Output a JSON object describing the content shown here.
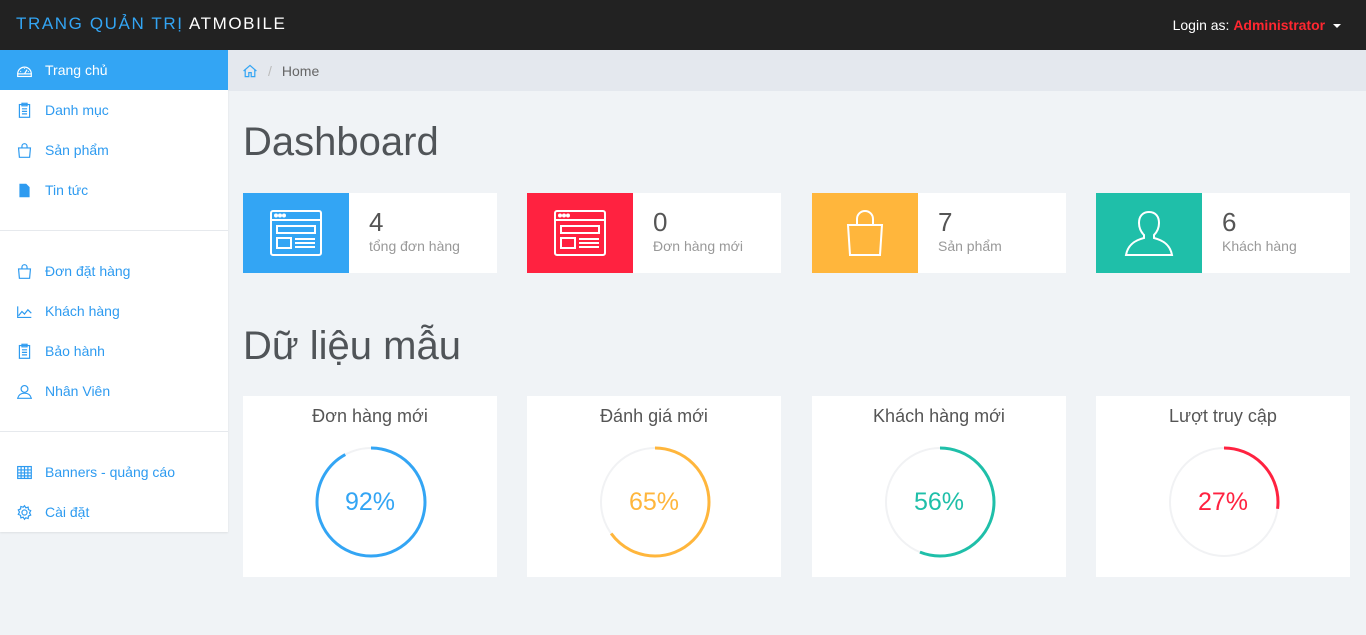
{
  "header": {
    "brand_part1": "TRANG QUẢN TRỊ",
    "brand_part2": "ATMOBILE",
    "login_prefix": "Login as:",
    "login_user": "Administrator"
  },
  "sidebar": {
    "items": [
      {
        "label": "Trang chủ",
        "icon": "dashboard-icon",
        "active": true
      },
      {
        "label": "Danh mục",
        "icon": "clipboard-list-icon"
      },
      {
        "label": "Sản phẩm",
        "icon": "shopping-bag-icon"
      },
      {
        "label": "Tin tức",
        "icon": "file-icon"
      },
      {
        "label": "Đơn đặt hàng",
        "icon": "shopping-bag-icon"
      },
      {
        "label": "Khách hàng",
        "icon": "line-chart-icon"
      },
      {
        "label": "Bảo hành",
        "icon": "clipboard-list-icon"
      },
      {
        "label": "Nhân Viên",
        "icon": "user-icon"
      },
      {
        "label": "Banners - quảng cáo",
        "icon": "table-grid-icon"
      },
      {
        "label": "Cài đặt",
        "icon": "gear-icon"
      }
    ]
  },
  "breadcrumb": {
    "current": "Home"
  },
  "dashboard": {
    "title": "Dashboard",
    "stats": [
      {
        "value": "4",
        "label": "tổng đơn hàng",
        "color": "#33a5f4",
        "icon": "browser-window-icon"
      },
      {
        "value": "0",
        "label": "Đơn hàng mới",
        "color": "#ff2240",
        "icon": "browser-window-icon"
      },
      {
        "value": "7",
        "label": "Sản phẩm",
        "color": "#ffb63c",
        "icon": "shopping-bag-icon"
      },
      {
        "value": "6",
        "label": "Khách hàng",
        "color": "#1fbfa9",
        "icon": "user-icon"
      }
    ]
  },
  "sample": {
    "title": "Dữ liệu mẫu",
    "gauges": [
      {
        "title": "Đơn hàng mới",
        "value_text": "92%",
        "percent": 92,
        "color": "#33a5f4"
      },
      {
        "title": "Đánh giá mới",
        "value_text": "65%",
        "percent": 65,
        "color": "#ffb63c"
      },
      {
        "title": "Khách hàng mới",
        "value_text": "56%",
        "percent": 56,
        "color": "#1fbfa9"
      },
      {
        "title": "Lượt truy cập",
        "value_text": "27%",
        "percent": 27,
        "color": "#ff2240"
      }
    ]
  }
}
